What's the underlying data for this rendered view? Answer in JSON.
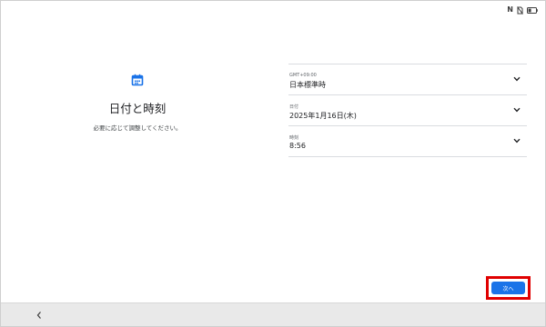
{
  "status_bar": {
    "nfc_text": "N",
    "icons": [
      "nfc-icon",
      "no-sim-icon",
      "battery-icon"
    ]
  },
  "header": {
    "icon": "calendar-icon",
    "title": "日付と時刻",
    "subtitle": "必要に応じて調整してください。"
  },
  "settings": {
    "timezone": {
      "label": "GMT+09:00",
      "value": "日本標準時"
    },
    "date": {
      "label": "日付",
      "value": "2025年1月16日(木)"
    },
    "time": {
      "label": "時刻",
      "value": "8:56"
    }
  },
  "footer": {
    "next_label": "次へ"
  },
  "nav": {
    "back_icon": "chevron-left-icon"
  },
  "colors": {
    "accent": "#1a73e8",
    "highlight": "#e00000",
    "nav_bg": "#e9e9e9",
    "divider": "#dadce0"
  }
}
